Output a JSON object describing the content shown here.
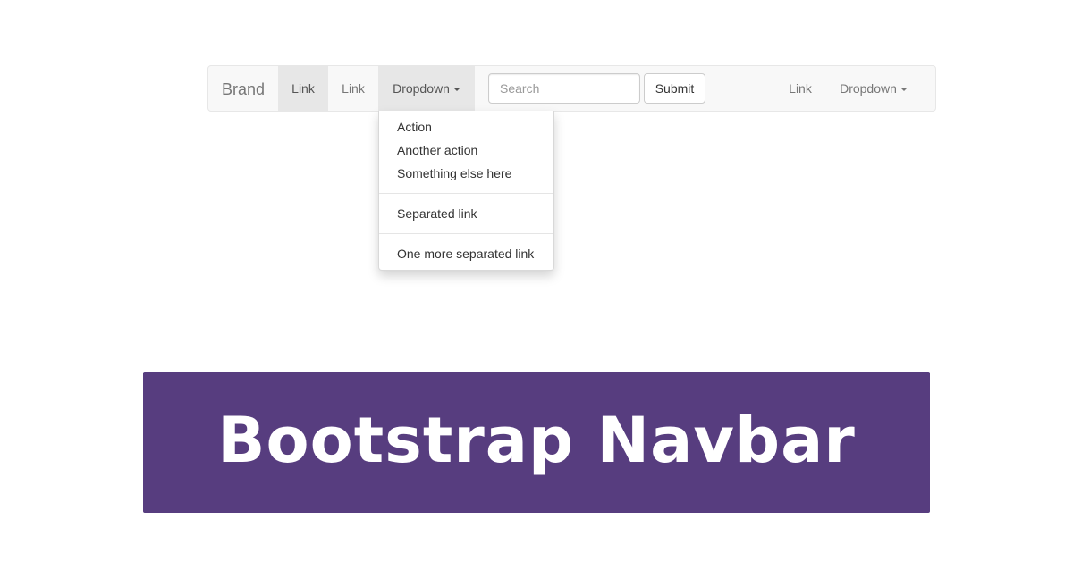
{
  "navbar": {
    "brand": "Brand",
    "left_links": [
      {
        "label": "Link",
        "active": true
      },
      {
        "label": "Link",
        "active": false
      }
    ],
    "dropdown_label": "Dropdown",
    "search": {
      "placeholder": "Search",
      "value": ""
    },
    "submit_label": "Submit",
    "right_link": "Link",
    "right_dropdown_label": "Dropdown"
  },
  "dropdown_menu": {
    "group1": [
      "Action",
      "Another action",
      "Something else here"
    ],
    "group2": [
      "Separated link"
    ],
    "group3": [
      "One more separated link"
    ]
  },
  "banner": {
    "title": "Bootstrap Navbar",
    "background": "#573d7f"
  },
  "colors": {
    "navbar_bg": "#f8f8f8",
    "navbar_border": "#e7e7e7",
    "active_bg": "#e7e7e7",
    "link_text": "#777777"
  },
  "icons": {
    "dropdown_caret": "caret-down-icon"
  }
}
